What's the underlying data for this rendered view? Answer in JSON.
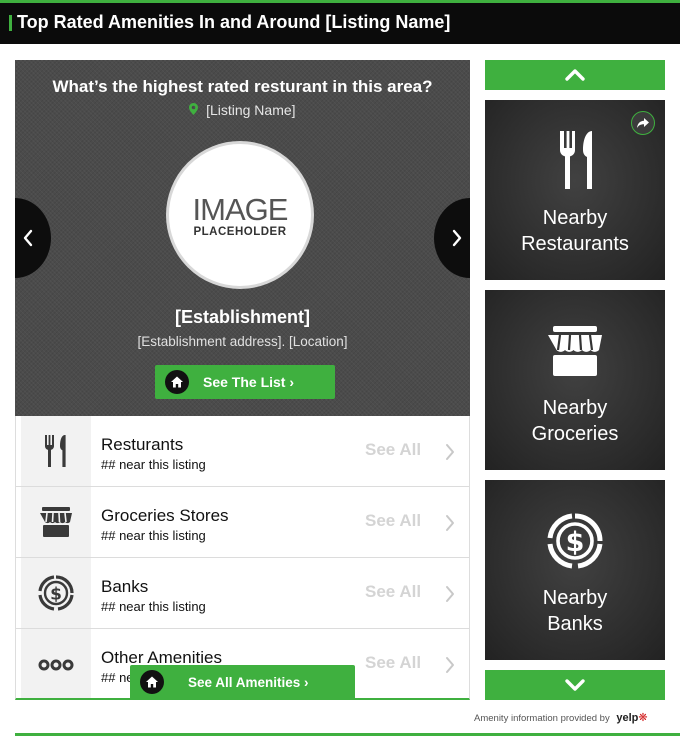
{
  "header": {
    "title": "Top Rated Amenities In and Around [Listing Name]"
  },
  "feature": {
    "question": "What’s the highest rated resturant in this area?",
    "location_icon": "map-pin-icon",
    "listing_name": "[Listing Name]",
    "image_placeholder": {
      "line1": "IMAGE",
      "line2": "PLACEHOLDER"
    },
    "establishment": "[Establishment]",
    "address": "[Establishment address]. [Location]",
    "see_list_label": "See The List"
  },
  "amenities": [
    {
      "icon": "fork-knife-icon",
      "name": "Resturants",
      "sub": "## near this listing",
      "see_all": "See All"
    },
    {
      "icon": "storefront-icon",
      "name": "Groceries Stores",
      "sub": "## near this listing",
      "see_all": "See All"
    },
    {
      "icon": "dollar-coin-icon",
      "name": "Banks",
      "sub": "## near this listing",
      "see_all": "See All"
    },
    {
      "icon": "more-dots-icon",
      "name": "Other Amenities",
      "sub": "## near this listing",
      "see_all": "See All"
    }
  ],
  "see_all_amenities_label": "See All Amenities",
  "sidebar": {
    "tiles": [
      {
        "icon": "fork-knife-icon",
        "line1": "Nearby",
        "line2": "Restaurants"
      },
      {
        "icon": "storefront-icon",
        "line1": "Nearby",
        "line2": "Groceries"
      },
      {
        "icon": "dollar-coin-icon",
        "line1": "Nearby",
        "line2": "Banks"
      }
    ]
  },
  "footer": {
    "credit": "Amenity information provided by",
    "brand": "yelp"
  },
  "colors": {
    "accent": "#3fb03f",
    "header_bg": "#0b0b0b",
    "feature_bg": "#4b4b4b",
    "tile_bg": "#2f2f2f"
  }
}
